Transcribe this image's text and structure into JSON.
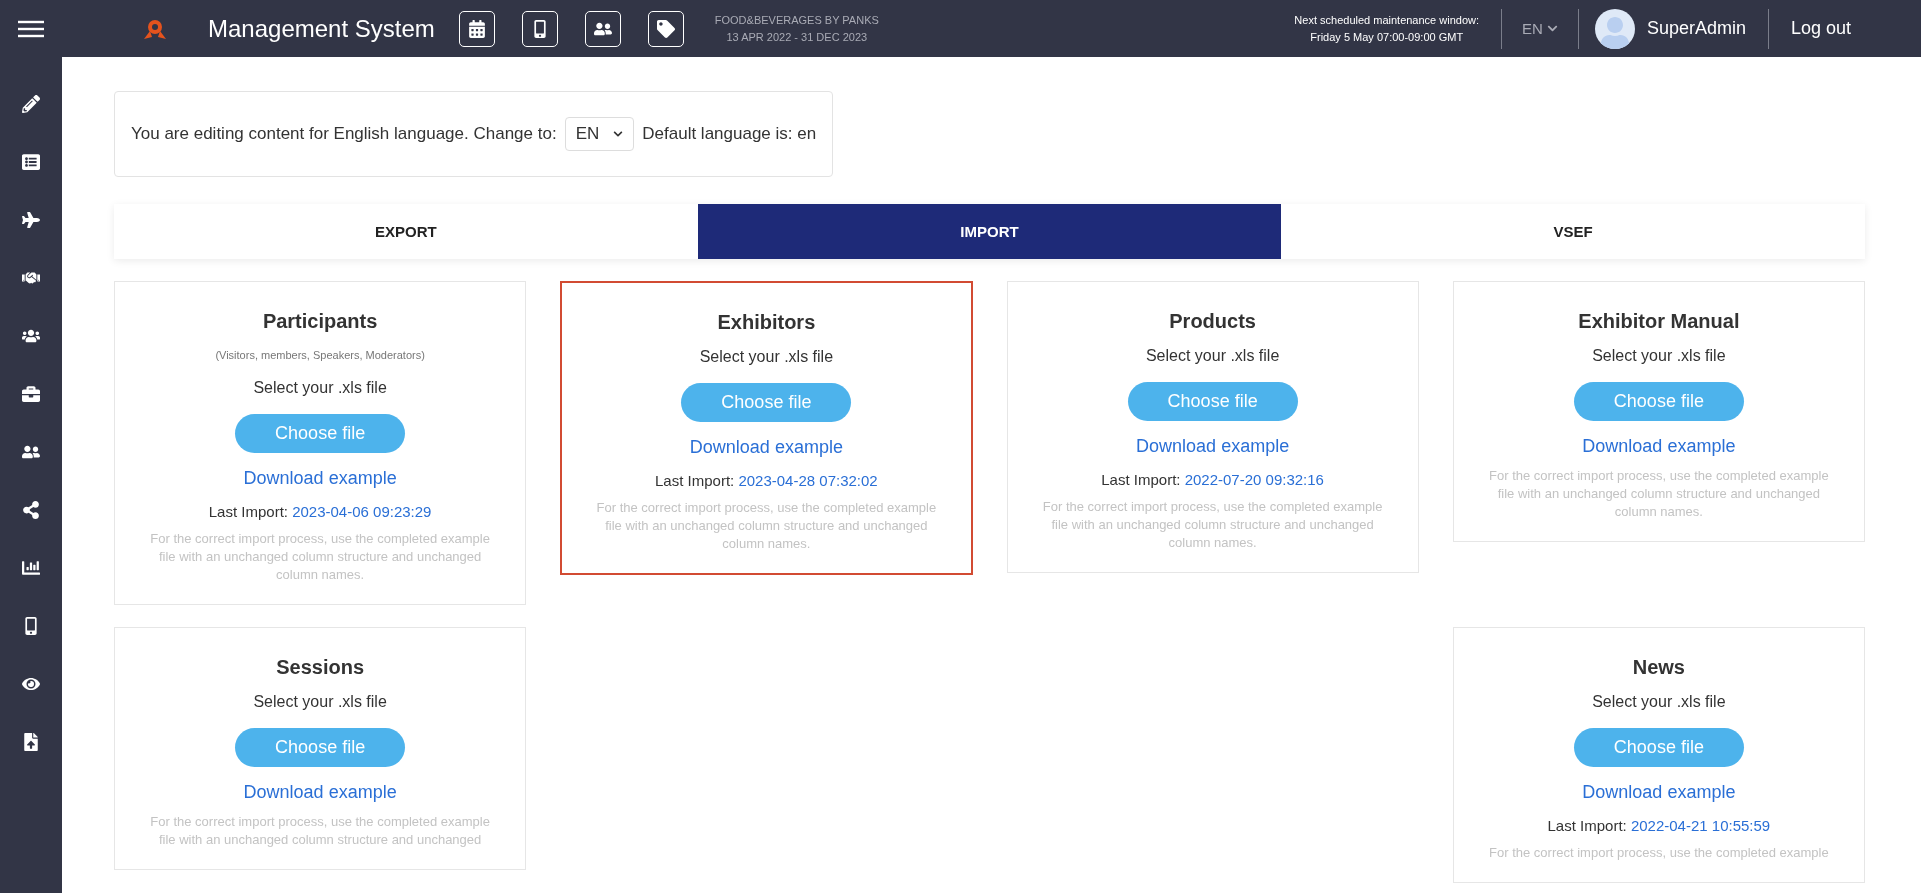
{
  "header": {
    "title": "Management System",
    "event": {
      "name": "FOOD&BEVERAGES BY PANKS",
      "dates": "13 APR 2022 - 31 DEC 2023"
    },
    "maintenance": {
      "label": "Next scheduled maintenance window:",
      "time": "Friday 5 May 07:00-09:00 GMT"
    },
    "language": "EN",
    "user": "SuperAdmin",
    "logout": "Log out"
  },
  "language_bar": {
    "text": "You are editing content for English language. Change to:",
    "select": "EN",
    "default": "Default language is: en"
  },
  "tabs": [
    {
      "label": "EXPORT",
      "selected": false
    },
    {
      "label": "IMPORT",
      "selected": true
    },
    {
      "label": "VSEF",
      "selected": false
    }
  ],
  "cards": [
    {
      "title": "Participants",
      "subtitle": "(Visitors, members, Speakers, Moderators)",
      "prompt": "Select your .xls file",
      "button": "Choose file",
      "link": "Download example",
      "last_import": {
        "label": "Last Import:",
        "value": "2023-04-06 09:23:29"
      },
      "hint": "For the correct import process, use the completed example file with an unchanged column structure and unchanged column names.",
      "highlighted": false
    },
    {
      "title": "Exhibitors",
      "prompt": "Select your .xls file",
      "button": "Choose file",
      "link": "Download example",
      "last_import": {
        "label": "Last Import:",
        "value": "2023-04-28 07:32:02"
      },
      "hint": "For the correct import process, use the completed example file with an unchanged column structure and unchanged column names.",
      "highlighted": true
    },
    {
      "title": "Products",
      "prompt": "Select your .xls file",
      "button": "Choose file",
      "link": "Download example",
      "last_import": {
        "label": "Last Import:",
        "value": "2022-07-20 09:32:16"
      },
      "hint": "For the correct import process, use the completed example file with an unchanged column structure and unchanged column names.",
      "highlighted": false
    },
    {
      "title": "Exhibitor Manual",
      "prompt": "Select your .xls file",
      "button": "Choose file",
      "link": "Download example",
      "hint": "For the correct import process, use the completed example file with an unchanged column structure and unchanged column names.",
      "highlighted": false
    },
    {
      "title": "Sessions",
      "prompt": "Select your .xls file",
      "button": "Choose file",
      "link": "Download example",
      "hint": "For the correct import process, use the completed example file with an unchanged column structure and unchanged",
      "highlighted": false
    },
    {
      "title": "News",
      "prompt": "Select your .xls file",
      "button": "Choose file",
      "link": "Download example",
      "last_import": {
        "label": "Last Import:",
        "value": "2022-04-21 10:55:59"
      },
      "hint": "For the correct import process, use the completed example",
      "highlighted": false
    }
  ]
}
